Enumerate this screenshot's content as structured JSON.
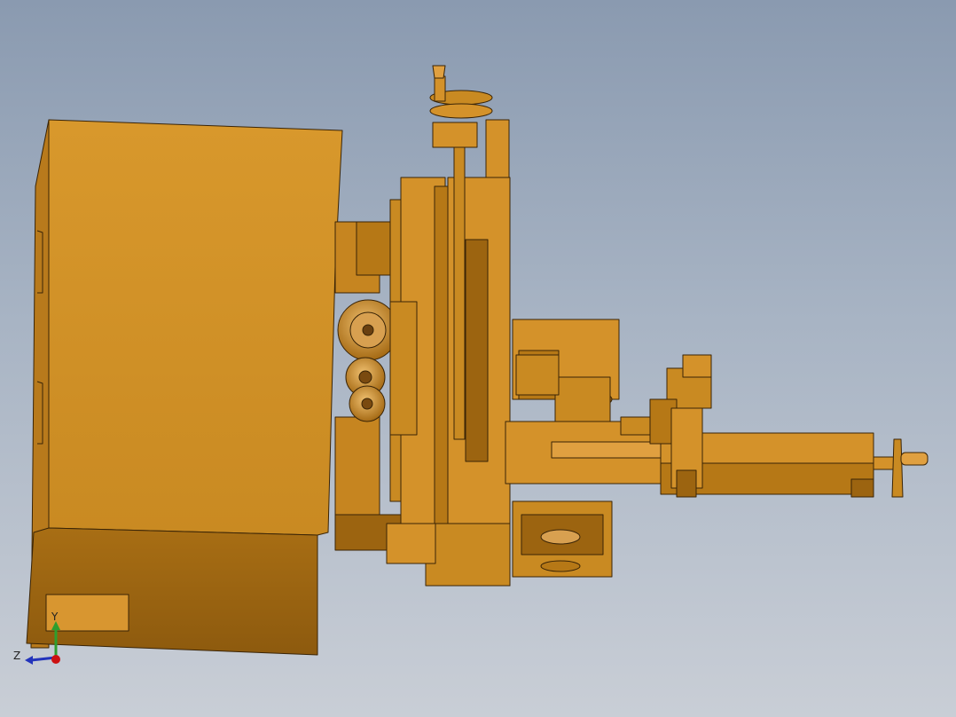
{
  "viewport": {
    "background_top": "#8a9ab0",
    "background_bottom": "#c9ced6",
    "part_color": "#d4922a",
    "part_shadow_color": "#9c6410",
    "edge_color": "#3a2406"
  },
  "triad": {
    "y_label": "Y",
    "z_label": "Z",
    "y_axis_color": "#2e9e2e",
    "z_axis_color": "#2233bb",
    "x_axis_color": "#cc1111"
  }
}
